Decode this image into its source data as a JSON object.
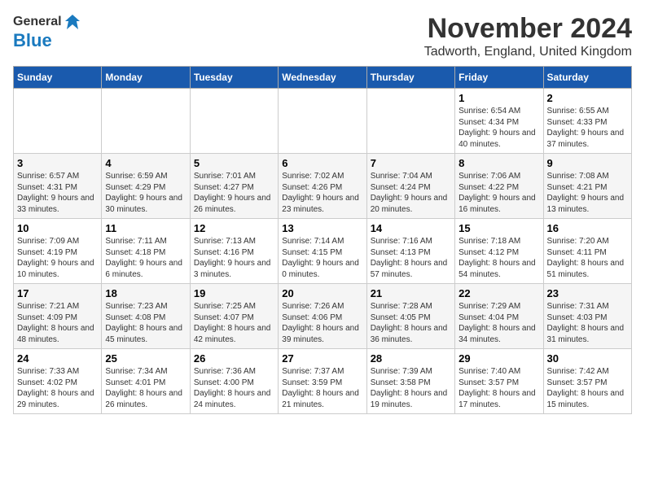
{
  "header": {
    "logo_general": "General",
    "logo_blue": "Blue",
    "month_title": "November 2024",
    "location": "Tadworth, England, United Kingdom"
  },
  "weekdays": [
    "Sunday",
    "Monday",
    "Tuesday",
    "Wednesday",
    "Thursday",
    "Friday",
    "Saturday"
  ],
  "weeks": [
    [
      {
        "day": "",
        "info": ""
      },
      {
        "day": "",
        "info": ""
      },
      {
        "day": "",
        "info": ""
      },
      {
        "day": "",
        "info": ""
      },
      {
        "day": "",
        "info": ""
      },
      {
        "day": "1",
        "info": "Sunrise: 6:54 AM\nSunset: 4:34 PM\nDaylight: 9 hours and 40 minutes."
      },
      {
        "day": "2",
        "info": "Sunrise: 6:55 AM\nSunset: 4:33 PM\nDaylight: 9 hours and 37 minutes."
      }
    ],
    [
      {
        "day": "3",
        "info": "Sunrise: 6:57 AM\nSunset: 4:31 PM\nDaylight: 9 hours and 33 minutes."
      },
      {
        "day": "4",
        "info": "Sunrise: 6:59 AM\nSunset: 4:29 PM\nDaylight: 9 hours and 30 minutes."
      },
      {
        "day": "5",
        "info": "Sunrise: 7:01 AM\nSunset: 4:27 PM\nDaylight: 9 hours and 26 minutes."
      },
      {
        "day": "6",
        "info": "Sunrise: 7:02 AM\nSunset: 4:26 PM\nDaylight: 9 hours and 23 minutes."
      },
      {
        "day": "7",
        "info": "Sunrise: 7:04 AM\nSunset: 4:24 PM\nDaylight: 9 hours and 20 minutes."
      },
      {
        "day": "8",
        "info": "Sunrise: 7:06 AM\nSunset: 4:22 PM\nDaylight: 9 hours and 16 minutes."
      },
      {
        "day": "9",
        "info": "Sunrise: 7:08 AM\nSunset: 4:21 PM\nDaylight: 9 hours and 13 minutes."
      }
    ],
    [
      {
        "day": "10",
        "info": "Sunrise: 7:09 AM\nSunset: 4:19 PM\nDaylight: 9 hours and 10 minutes."
      },
      {
        "day": "11",
        "info": "Sunrise: 7:11 AM\nSunset: 4:18 PM\nDaylight: 9 hours and 6 minutes."
      },
      {
        "day": "12",
        "info": "Sunrise: 7:13 AM\nSunset: 4:16 PM\nDaylight: 9 hours and 3 minutes."
      },
      {
        "day": "13",
        "info": "Sunrise: 7:14 AM\nSunset: 4:15 PM\nDaylight: 9 hours and 0 minutes."
      },
      {
        "day": "14",
        "info": "Sunrise: 7:16 AM\nSunset: 4:13 PM\nDaylight: 8 hours and 57 minutes."
      },
      {
        "day": "15",
        "info": "Sunrise: 7:18 AM\nSunset: 4:12 PM\nDaylight: 8 hours and 54 minutes."
      },
      {
        "day": "16",
        "info": "Sunrise: 7:20 AM\nSunset: 4:11 PM\nDaylight: 8 hours and 51 minutes."
      }
    ],
    [
      {
        "day": "17",
        "info": "Sunrise: 7:21 AM\nSunset: 4:09 PM\nDaylight: 8 hours and 48 minutes."
      },
      {
        "day": "18",
        "info": "Sunrise: 7:23 AM\nSunset: 4:08 PM\nDaylight: 8 hours and 45 minutes."
      },
      {
        "day": "19",
        "info": "Sunrise: 7:25 AM\nSunset: 4:07 PM\nDaylight: 8 hours and 42 minutes."
      },
      {
        "day": "20",
        "info": "Sunrise: 7:26 AM\nSunset: 4:06 PM\nDaylight: 8 hours and 39 minutes."
      },
      {
        "day": "21",
        "info": "Sunrise: 7:28 AM\nSunset: 4:05 PM\nDaylight: 8 hours and 36 minutes."
      },
      {
        "day": "22",
        "info": "Sunrise: 7:29 AM\nSunset: 4:04 PM\nDaylight: 8 hours and 34 minutes."
      },
      {
        "day": "23",
        "info": "Sunrise: 7:31 AM\nSunset: 4:03 PM\nDaylight: 8 hours and 31 minutes."
      }
    ],
    [
      {
        "day": "24",
        "info": "Sunrise: 7:33 AM\nSunset: 4:02 PM\nDaylight: 8 hours and 29 minutes."
      },
      {
        "day": "25",
        "info": "Sunrise: 7:34 AM\nSunset: 4:01 PM\nDaylight: 8 hours and 26 minutes."
      },
      {
        "day": "26",
        "info": "Sunrise: 7:36 AM\nSunset: 4:00 PM\nDaylight: 8 hours and 24 minutes."
      },
      {
        "day": "27",
        "info": "Sunrise: 7:37 AM\nSunset: 3:59 PM\nDaylight: 8 hours and 21 minutes."
      },
      {
        "day": "28",
        "info": "Sunrise: 7:39 AM\nSunset: 3:58 PM\nDaylight: 8 hours and 19 minutes."
      },
      {
        "day": "29",
        "info": "Sunrise: 7:40 AM\nSunset: 3:57 PM\nDaylight: 8 hours and 17 minutes."
      },
      {
        "day": "30",
        "info": "Sunrise: 7:42 AM\nSunset: 3:57 PM\nDaylight: 8 hours and 15 minutes."
      }
    ]
  ]
}
